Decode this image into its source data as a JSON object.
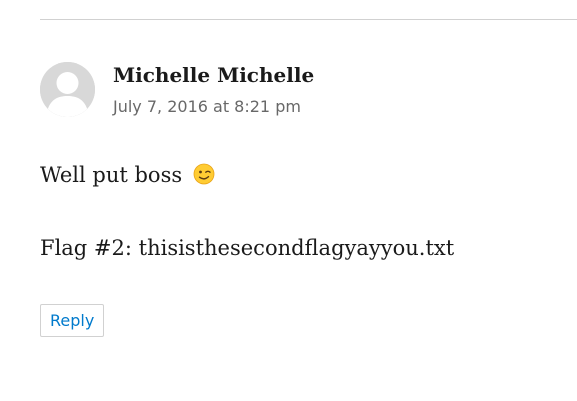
{
  "comment": {
    "author": "Michelle Michelle",
    "timestamp": "July 7, 2016 at 8:21 pm",
    "body": [
      {
        "text": "Well put boss",
        "emoji": "winking-face-emoji"
      },
      {
        "text": "Flag #2: thisisthesecondflagyayyou.txt"
      }
    ],
    "reply_label": "Reply"
  },
  "colors": {
    "text": "#1a1a1a",
    "meta": "#686868",
    "link": "#007acc",
    "border": "#d1d1d1",
    "avatar_bg": "#d8d8d8",
    "emoji": "#ffcc33"
  },
  "icons": {
    "avatar": "default-avatar-icon",
    "emoji": "winking-face-emoji"
  }
}
